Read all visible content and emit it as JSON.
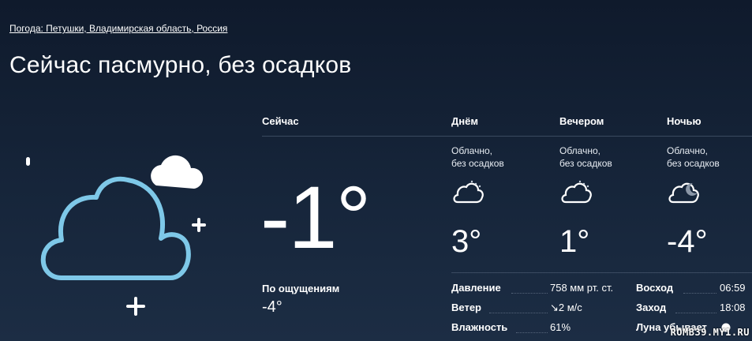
{
  "breadcrumb": "Погода: Петушки, Владимирская область, Россия",
  "headline": "Сейчас пасмурно, без осадков",
  "now": {
    "label": "Сейчас",
    "temp": "-1°",
    "feels_label": "По ощущениям",
    "feels_value": "-4°"
  },
  "periods": [
    {
      "label": "Днём",
      "desc_line1": "Облачно,",
      "desc_line2": "без осадков",
      "temp": "3°",
      "icon": "cloudy-sun-icon"
    },
    {
      "label": "Вечером",
      "desc_line1": "Облачно,",
      "desc_line2": "без осадков",
      "temp": "1°",
      "icon": "cloudy-sun-icon"
    },
    {
      "label": "Ночью",
      "desc_line1": "Облачно,",
      "desc_line2": "без осадков",
      "temp": "-4°",
      "icon": "cloudy-moon-icon"
    }
  ],
  "stats": {
    "pressure_label": "Давление",
    "pressure_value": "758 мм рт. ст.",
    "wind_label": "Ветер",
    "wind_value": "↘2 м/с",
    "humidity_label": "Влажность",
    "humidity_value": "61%"
  },
  "sun": {
    "sunrise_label": "Восход",
    "sunrise_value": "06:59",
    "sunset_label": "Заход",
    "sunset_value": "18:08",
    "moon_label": "Луна убывает"
  },
  "watermark": "ROMB39.MY1.RU",
  "colors": {
    "background": "#13213a",
    "icon_outline": "#7ec8e8",
    "text": "#ffffff"
  }
}
